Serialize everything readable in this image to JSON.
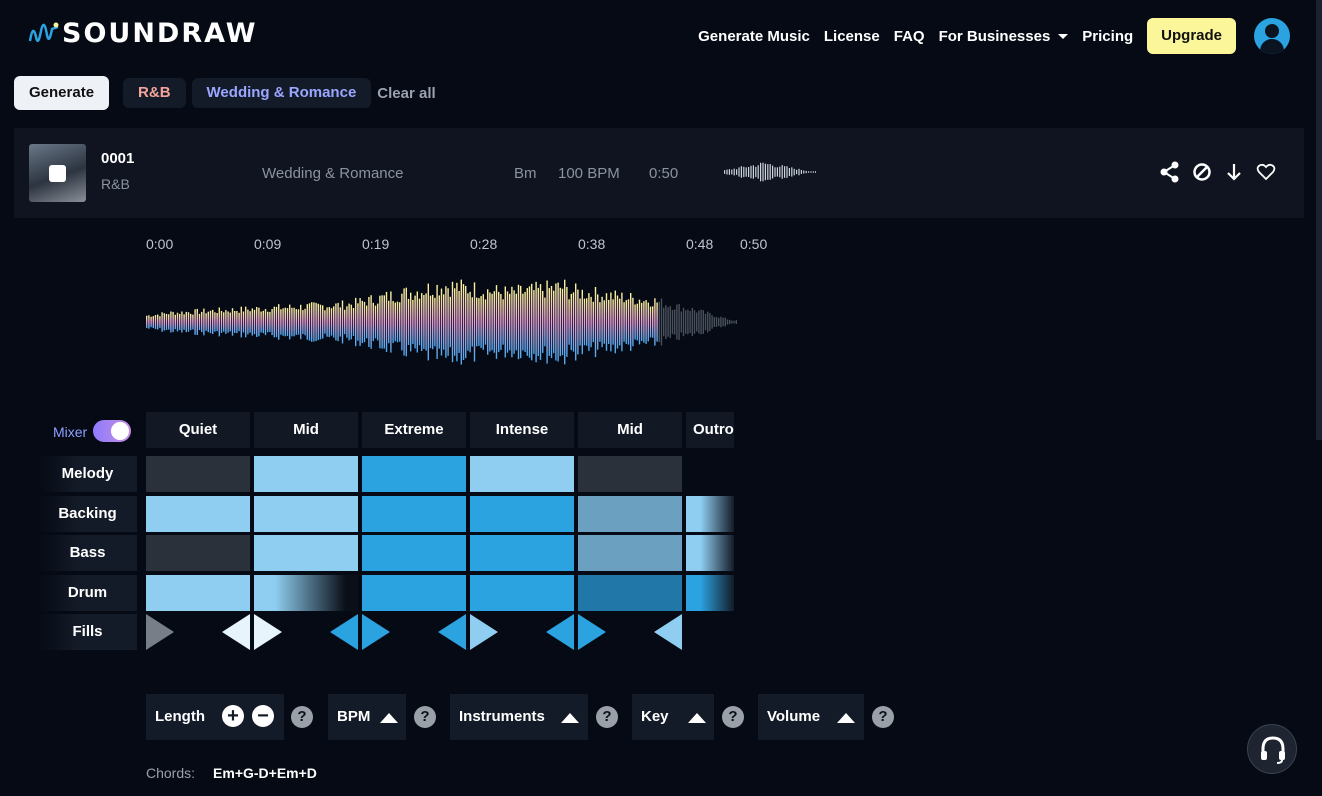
{
  "header": {
    "logo_text": "SOUNDRAW",
    "nav": [
      "Generate Music",
      "License",
      "FAQ",
      "For Businesses",
      "Pricing"
    ],
    "upgrade_label": "Upgrade"
  },
  "filters": {
    "generate_label": "Generate",
    "tags": [
      "R&B",
      "Wedding & Romance"
    ],
    "clear_label": "Clear all"
  },
  "track": {
    "number": "0001",
    "genre": "R&B",
    "mood": "Wedding & Romance",
    "key": "Bm",
    "bpm": "100 BPM",
    "duration": "0:50"
  },
  "timeline": [
    "0:00",
    "0:09",
    "0:19",
    "0:28",
    "0:38",
    "0:48",
    "0:50"
  ],
  "mixer": {
    "label": "Mixer",
    "enabled": true,
    "sections": [
      "Quiet",
      "Mid",
      "Extreme",
      "Intense",
      "Mid",
      "Outro"
    ],
    "rows": [
      "Melody",
      "Backing",
      "Bass",
      "Drum",
      "Fills"
    ]
  },
  "controls": {
    "length": "Length",
    "bpm": "BPM",
    "instruments": "Instruments",
    "key": "Key",
    "volume": "Volume",
    "help": "?"
  },
  "chords": {
    "label": "Chords:",
    "value": "Em+G-D+Em+D"
  },
  "colors": {
    "accent": "#2aa3e0",
    "light": "#8fcef0",
    "dark": "#2a313b",
    "muted": "#6ba0c0",
    "upgrade": "#fcf69a"
  }
}
